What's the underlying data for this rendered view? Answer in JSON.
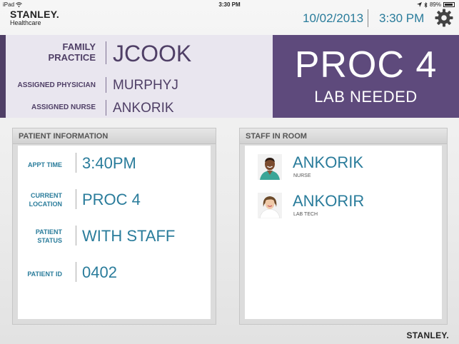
{
  "status_bar": {
    "device": "iPad",
    "time": "3:30 PM",
    "battery": "89%"
  },
  "brand": {
    "name": "STANLEY.",
    "sub": "Healthcare",
    "footer": "STANLEY."
  },
  "header": {
    "date": "10/02/2013",
    "time": "3:30 PM"
  },
  "banner": {
    "practice_label_1": "FAMILY",
    "practice_label_2": "PRACTICE",
    "practice_value": "JCOOK",
    "physician_label": "ASSIGNED PHYSICIAN",
    "physician_value": "MURPHYJ",
    "nurse_label": "ASSIGNED NURSE",
    "nurse_value": "ANKORIK",
    "room": "PROC 4",
    "room_status": "LAB NEEDED"
  },
  "patient_panel": {
    "title": "PATIENT INFORMATION",
    "rows": [
      {
        "label_1": "APPT TIME",
        "label_2": "",
        "value": "3:40PM"
      },
      {
        "label_1": "CURRENT",
        "label_2": "LOCATION",
        "value": "PROC 4"
      },
      {
        "label_1": "PATIENT",
        "label_2": "STATUS",
        "value": "WITH STAFF"
      },
      {
        "label_1": "PATIENT ID",
        "label_2": "",
        "value": "0402"
      }
    ]
  },
  "staff_panel": {
    "title": "STAFF IN ROOM",
    "members": [
      {
        "name": "ANKORIK",
        "role": "NURSE",
        "avatar": "male-avatar-icon"
      },
      {
        "name": "ANKORIR",
        "role": "LAB TECH",
        "avatar": "female-avatar-icon"
      }
    ]
  },
  "colors": {
    "accent": "#2a7c9b",
    "purple": "#5e4a7c",
    "purple_text": "#4f3f66"
  }
}
